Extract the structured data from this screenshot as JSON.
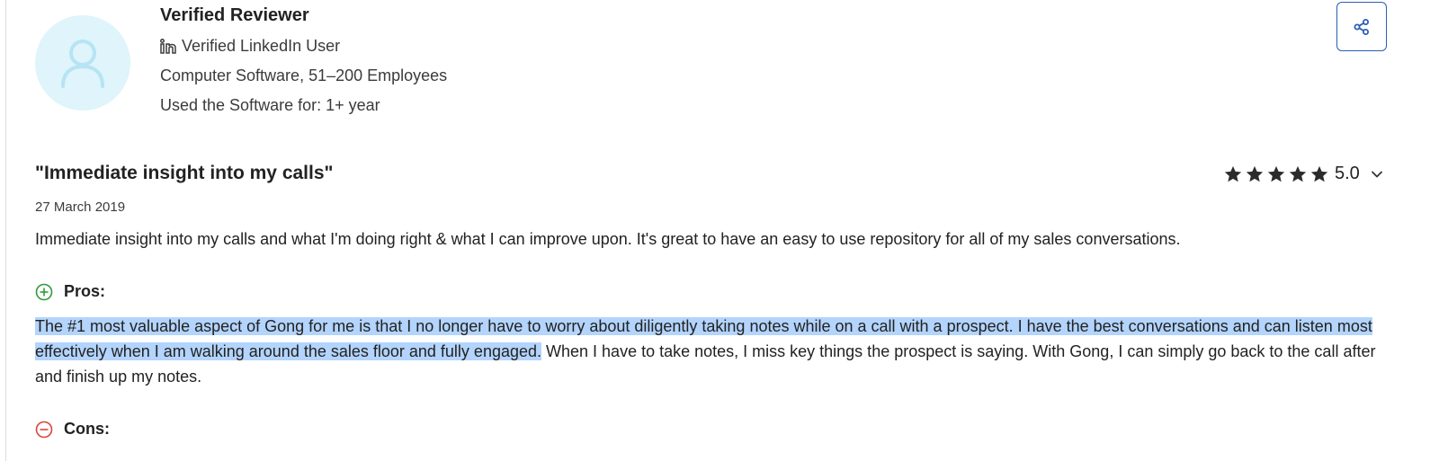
{
  "reviewer": {
    "name": "Verified Reviewer",
    "verification": "Verified LinkedIn User",
    "company": "Computer Software, 51–200 Employees",
    "usage": "Used the Software for: 1+ year",
    "linkedin_icon": "linkedin-icon",
    "avatar_icon": "person-icon"
  },
  "share": {
    "icon": "share-icon"
  },
  "review": {
    "title": "\"Immediate insight into my calls\"",
    "date": "27 March 2019",
    "summary": "Immediate insight into my calls and what I'm doing right & what I can improve upon. It's great to have an easy to use repository for all of my sales conversations.",
    "rating": {
      "value": "5.0",
      "stars": 5,
      "max": 5
    },
    "pros": {
      "label": "Pros:",
      "text_highlighted": "The #1 most valuable aspect of Gong for me is that I no longer have to worry about diligently taking notes while on a call with a prospect. I have the best conversations and can listen most effectively when I am walking around the sales floor and fully engaged.",
      "text_rest": " When I have to take notes, I miss key things the prospect is saying. With Gong, I can simply go back to the call after and finish up my notes."
    },
    "cons": {
      "label": "Cons:"
    }
  },
  "colors": {
    "accent": "#2a5fb3",
    "pros": "#2e9b3a",
    "cons": "#d9453b",
    "highlight": "#b3d4fc",
    "avatar_bg": "#dff4fb",
    "avatar_fg": "#b6e4f4"
  }
}
